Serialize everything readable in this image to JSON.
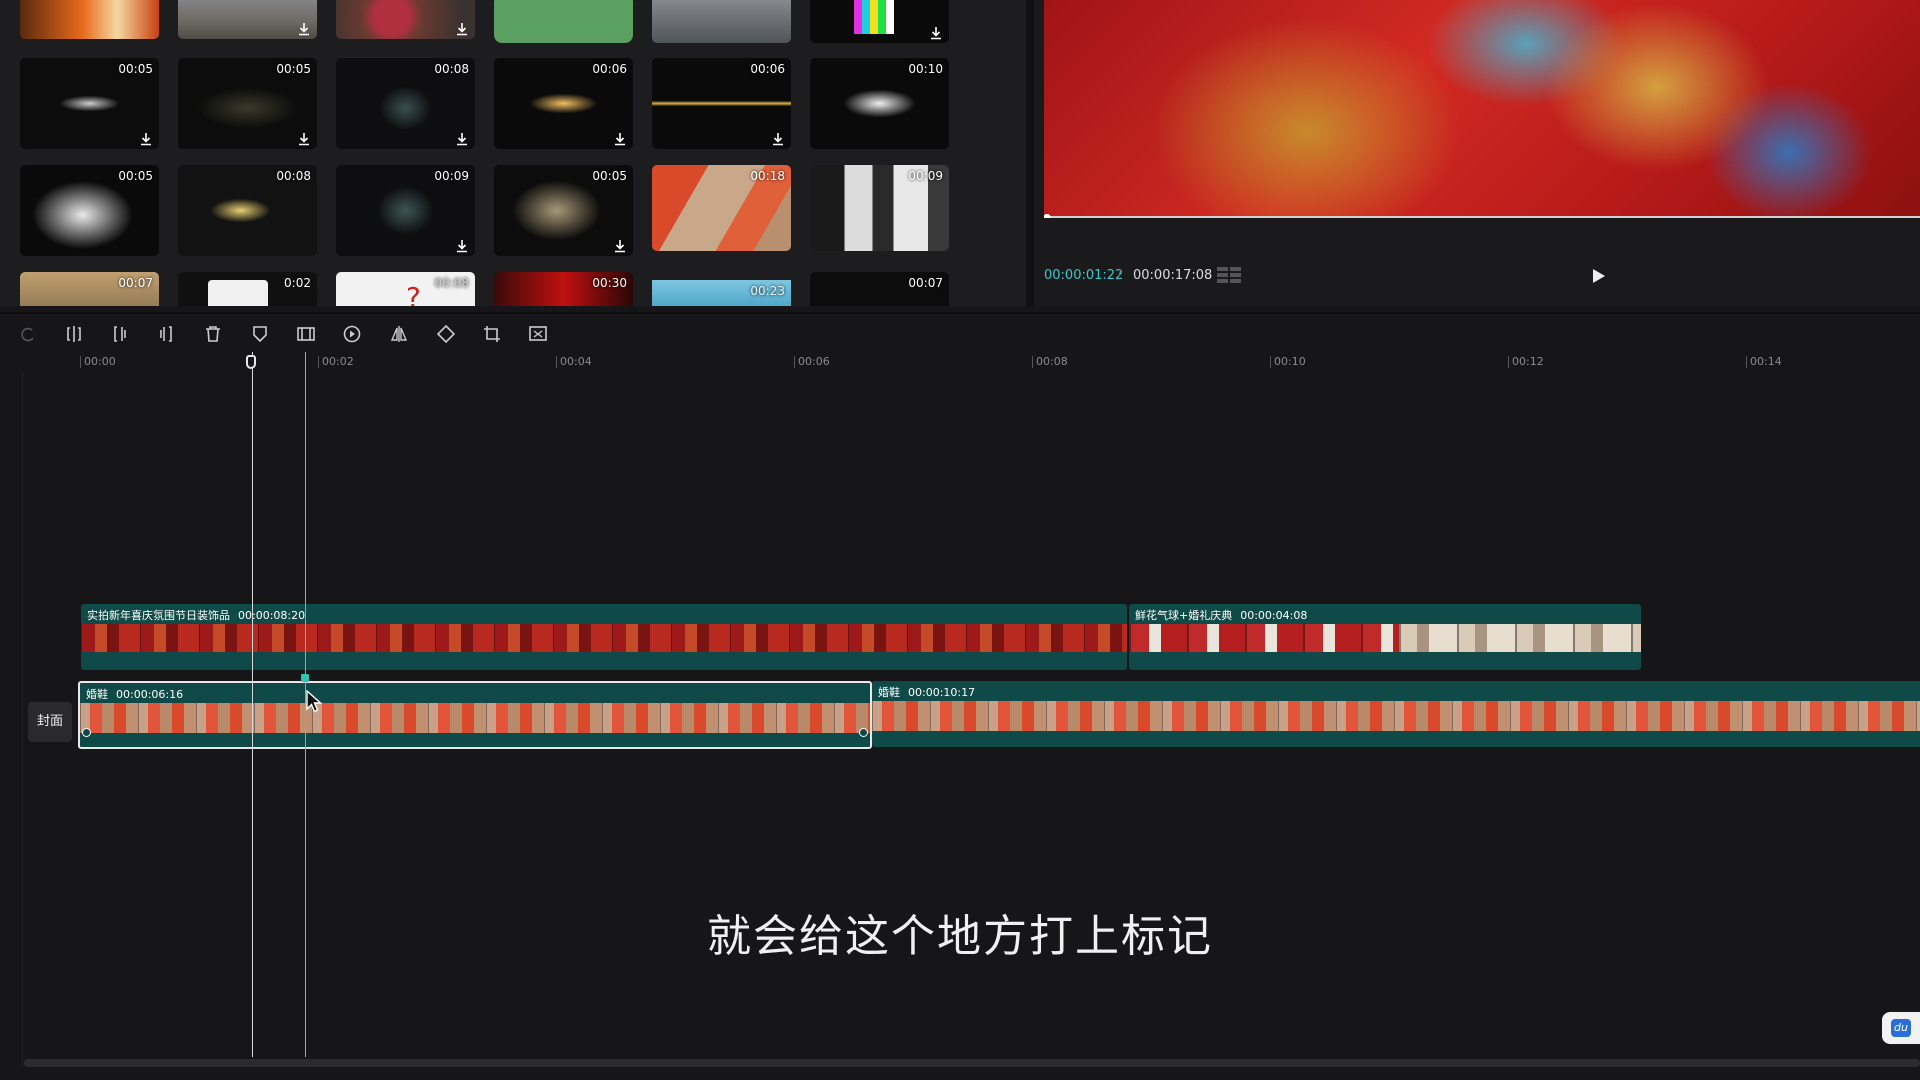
{
  "library": {
    "rows": [
      [
        {
          "duration": "",
          "style": "fire"
        },
        {
          "duration": "",
          "style": "beach"
        },
        {
          "duration": "",
          "style": "flowers"
        },
        {
          "duration": "",
          "style": "green"
        },
        {
          "duration": "",
          "style": "mist"
        },
        {
          "duration": "",
          "style": "colorbars"
        }
      ],
      [
        {
          "duration": "00:05",
          "style": "smoke-wisp"
        },
        {
          "duration": "00:05",
          "style": "particles"
        },
        {
          "duration": "00:08",
          "style": "dark-spark"
        },
        {
          "duration": "00:06",
          "style": "gold-spark"
        },
        {
          "duration": "00:06",
          "style": "lens-flare"
        },
        {
          "duration": "00:10",
          "style": "white-smoke"
        }
      ],
      [
        {
          "duration": "00:05",
          "style": "cloud"
        },
        {
          "duration": "00:08",
          "style": "gold-burst"
        },
        {
          "duration": "00:09",
          "style": "teal-smoke"
        },
        {
          "duration": "00:05",
          "style": "color-smoke"
        },
        {
          "duration": "00:18",
          "style": "shoes"
        },
        {
          "duration": "00:09",
          "style": "wedding"
        }
      ],
      [
        {
          "duration": "00:07",
          "style": "room"
        },
        {
          "duration": "0:02",
          "style": "question"
        },
        {
          "duration": "00:08",
          "style": "question-red"
        },
        {
          "duration": "00:30",
          "style": "red-dark"
        },
        {
          "duration": "00:23",
          "style": "water"
        },
        {
          "duration": "00:07",
          "style": "black"
        }
      ]
    ]
  },
  "preview": {
    "current_time": "00:00:01:22",
    "separator": "/",
    "total_time": "00:00:17:08"
  },
  "toolbar": {
    "tools": [
      "undo-icon",
      "split-icon",
      "trim-left-icon",
      "trim-right-icon",
      "delete-icon",
      "marker-icon",
      "freeze-icon",
      "reverse-icon",
      "mirror-icon",
      "rotate-icon",
      "crop-icon",
      "remove-bg-icon"
    ]
  },
  "ruler": {
    "ticks": [
      "00:00",
      "00:02",
      "00:04",
      "00:06",
      "00:08",
      "00:10",
      "00:12",
      "00:14"
    ]
  },
  "tracks": {
    "upper": [
      {
        "title": "实拍新年喜庆氛围节日装饰品",
        "duration": "00:00:08:20"
      },
      {
        "title": "鲜花气球+婚礼庆典",
        "duration": "00:00:04:08"
      }
    ],
    "main": [
      {
        "title": "婚鞋",
        "duration": "00:00:06:16"
      },
      {
        "title": "婚鞋",
        "duration": "00:00:10:17"
      }
    ]
  },
  "cover_label": "封面",
  "subtitle": "就会给这个地方打上标记",
  "badge_text": "du"
}
